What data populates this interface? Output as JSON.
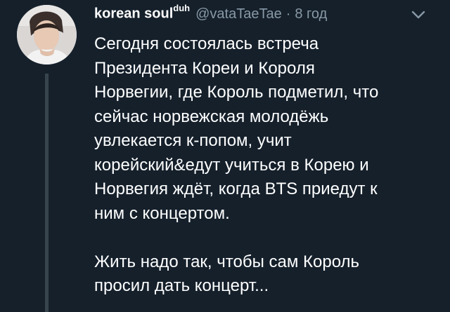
{
  "tweet": {
    "display_name": "korean soul",
    "display_name_sup": "duh",
    "handle": "@vataTaeTae",
    "separator": "·",
    "timestamp": "8 год",
    "avatar_icon": "profile-photo",
    "menu_icon": "chevron-down-icon",
    "text_lines": [
      "Сегодня состоялась встреча",
      "Президента Кореи и Короля",
      "Норвегии, где Король подметил, что",
      "сейчас норвежская молодёжь",
      "увлекается к-попом, учит",
      "корейский&едут учиться в Корею и",
      "Норвегия ждёт, когда BTS приедут к",
      "ним с концертом."
    ],
    "text_lines_2": [
      "Жить надо так, чтобы сам Король",
      "просил дать концерт..."
    ]
  },
  "colors": {
    "background": "#15202b",
    "text": "#ffffff",
    "secondary_text": "#8899a6",
    "thread_line": "#38444d"
  }
}
